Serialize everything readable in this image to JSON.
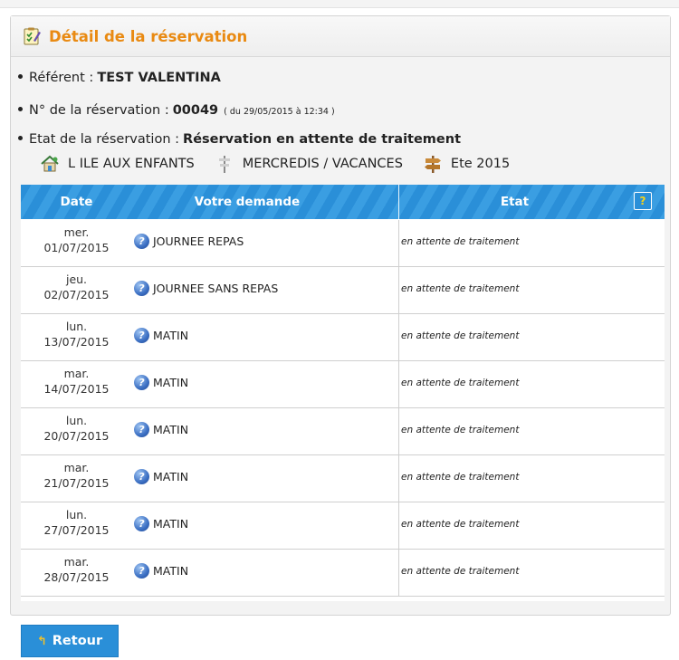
{
  "panel": {
    "title": "Détail de la réservation"
  },
  "info": {
    "referent_label": "Référent :",
    "referent_value": "TEST VALENTINA",
    "numero_label": "N° de la réservation :",
    "numero_value": "00049",
    "numero_detail": "( du 29/05/2015 à 12:34 )",
    "etat_label": "Etat de la réservation :",
    "etat_value": "Réservation en attente de traitement"
  },
  "crumbs": {
    "structure": "L ILE AUX ENFANTS",
    "activite": "MERCREDIS / VACANCES",
    "periode": "Ete 2015",
    "icons": [
      "house-icon",
      "signpost-icon",
      "direction-sign-icon"
    ]
  },
  "table": {
    "headers": {
      "date": "Date",
      "demande": "Votre demande",
      "etat": "Etat"
    },
    "help_label": "?",
    "rows": [
      {
        "day": "mer.",
        "date": "01/07/2015",
        "demande": "JOURNEE REPAS",
        "etat": "en attente de traitement"
      },
      {
        "day": "jeu.",
        "date": "02/07/2015",
        "demande": "JOURNEE SANS REPAS",
        "etat": "en attente de traitement"
      },
      {
        "day": "lun.",
        "date": "13/07/2015",
        "demande": "MATIN",
        "etat": "en attente de traitement"
      },
      {
        "day": "mar.",
        "date": "14/07/2015",
        "demande": "MATIN",
        "etat": "en attente de traitement"
      },
      {
        "day": "lun.",
        "date": "20/07/2015",
        "demande": "MATIN",
        "etat": "en attente de traitement"
      },
      {
        "day": "mar.",
        "date": "21/07/2015",
        "demande": "MATIN",
        "etat": "en attente de traitement"
      },
      {
        "day": "lun.",
        "date": "27/07/2015",
        "demande": "MATIN",
        "etat": "en attente de traitement"
      },
      {
        "day": "mar.",
        "date": "28/07/2015",
        "demande": "MATIN",
        "etat": "en attente de traitement"
      }
    ]
  },
  "footer": {
    "back_label": "Retour"
  },
  "colors": {
    "accent_orange": "#e98a12",
    "header_blue": "#2a8fd8",
    "help_yellow": "#f5d21a"
  }
}
